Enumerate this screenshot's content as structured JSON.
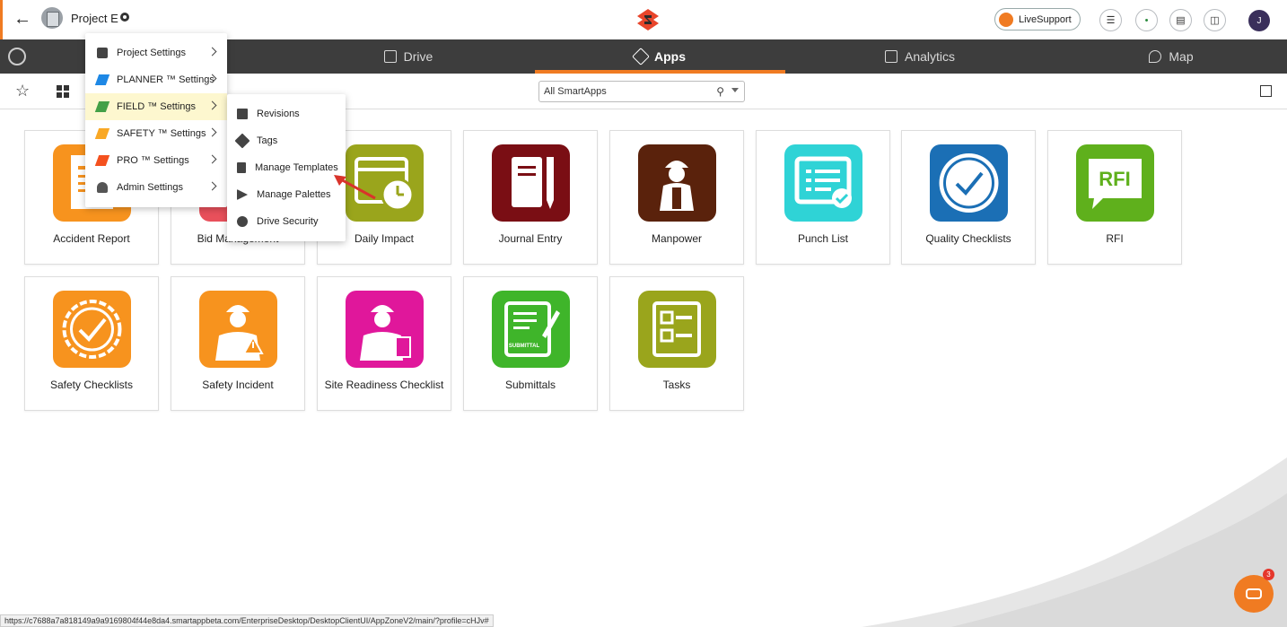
{
  "header": {
    "project_name": "Project E",
    "live_support_label": "LiveSupport",
    "user_initial": "J"
  },
  "nav": {
    "tabs": [
      {
        "label": "Drive",
        "icon": "drive-icon"
      },
      {
        "label": "Apps",
        "icon": "apps-icon",
        "active": true
      },
      {
        "label": "Analytics",
        "icon": "analytics-icon"
      },
      {
        "label": "Map",
        "icon": "map-icon"
      }
    ]
  },
  "toolbar": {
    "search_value": "All SmartApps"
  },
  "settings_menu": {
    "items": [
      {
        "label": "Project Settings",
        "icon": "camera-icon"
      },
      {
        "label": "PLANNER ™ Settings",
        "icon": "hammer-blue-icon"
      },
      {
        "label": "FIELD ™ Settings",
        "icon": "hammer-green-icon",
        "highlighted": true
      },
      {
        "label": "SAFETY ™ Settings",
        "icon": "hammer-yellow-icon"
      },
      {
        "label": "PRO ™ Settings",
        "icon": "hammer-orange-icon"
      },
      {
        "label": "Admin Settings",
        "icon": "admin-icon"
      }
    ]
  },
  "field_submenu": {
    "items": [
      {
        "label": "Revisions",
        "icon": "revisions-icon"
      },
      {
        "label": "Tags",
        "icon": "tag-icon"
      },
      {
        "label": "Manage Templates",
        "icon": "template-icon"
      },
      {
        "label": "Manage Palettes",
        "icon": "palette-icon"
      },
      {
        "label": "Drive Security",
        "icon": "security-icon"
      }
    ]
  },
  "apps": [
    {
      "label": "Accident Report",
      "color": "#f7931e"
    },
    {
      "label": "Bid Management",
      "color": "#e8505b"
    },
    {
      "label": "Daily Impact",
      "color": "#9aa51c"
    },
    {
      "label": "Journal Entry",
      "color": "#7a0e14"
    },
    {
      "label": "Manpower",
      "color": "#5a220c"
    },
    {
      "label": "Punch List",
      "color": "#2fd3d6"
    },
    {
      "label": "Quality Checklists",
      "color": "#1b6fb5"
    },
    {
      "label": "RFI",
      "color": "#5fb01c",
      "icon_text": "RFI"
    },
    {
      "label": "Safety Checklists",
      "color": "#f7931e"
    },
    {
      "label": "Safety Incident",
      "color": "#f7931e"
    },
    {
      "label": "Site Readiness Checklist",
      "color": "#e0179b"
    },
    {
      "label": "Submittals",
      "color": "#3fb52a",
      "icon_text": "SUBMITTAL"
    },
    {
      "label": "Tasks",
      "color": "#9aa51c"
    }
  ],
  "status_url": "https://c7688a7a818149a9a9169804f44e8da4.smartappbeta.com/EnterpriseDesktop/DesktopClientUI/AppZoneV2/main/?profile=cHJv#",
  "chat_badge_count": "3",
  "colors": {
    "accent": "#f07b22",
    "navbar": "#3d3d3d",
    "highlight": "#fdf7cf"
  }
}
